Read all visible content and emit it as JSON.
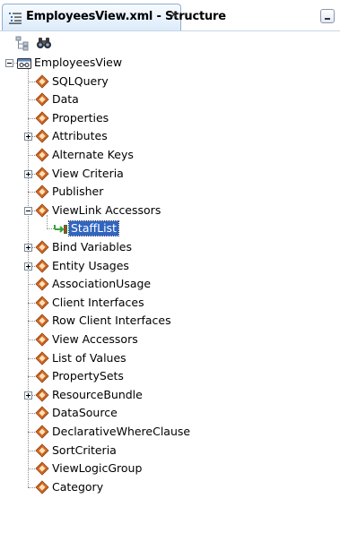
{
  "window": {
    "tab_title": "EmployeesView.xml - Structure",
    "close_glyph": "×"
  },
  "toolbar": {
    "buttons": [
      {
        "icon": "hierarchy-icon"
      },
      {
        "icon": "binoculars-icon"
      }
    ]
  },
  "colors": {
    "tab_bg": "#dcebfa",
    "selection_bg": "#3165c0",
    "node_icon": "#d9702a",
    "link_icon": "#3aa23a"
  },
  "tree": {
    "root": {
      "label": "EmployeesView",
      "icon": "view-object-icon",
      "state": "expanded"
    },
    "nodes": [
      {
        "label": "SQLQuery",
        "icon": "diamond-node-icon",
        "depth": 1,
        "expander": "none"
      },
      {
        "label": "Data",
        "icon": "diamond-node-icon",
        "depth": 1,
        "expander": "none"
      },
      {
        "label": "Properties",
        "icon": "diamond-node-icon",
        "depth": 1,
        "expander": "none"
      },
      {
        "label": "Attributes",
        "icon": "diamond-node-icon",
        "depth": 1,
        "expander": "collapsed"
      },
      {
        "label": "Alternate Keys",
        "icon": "diamond-node-icon",
        "depth": 1,
        "expander": "none"
      },
      {
        "label": "View Criteria",
        "icon": "diamond-node-icon",
        "depth": 1,
        "expander": "collapsed"
      },
      {
        "label": "Publisher",
        "icon": "diamond-node-icon",
        "depth": 1,
        "expander": "none"
      },
      {
        "label": "ViewLink Accessors",
        "icon": "diamond-node-icon",
        "depth": 1,
        "expander": "expanded"
      },
      {
        "label": "StaffList",
        "icon": "view-link-icon",
        "depth": 2,
        "expander": "none",
        "selected": true
      },
      {
        "label": "Bind Variables",
        "icon": "diamond-node-icon",
        "depth": 1,
        "expander": "collapsed"
      },
      {
        "label": "Entity Usages",
        "icon": "diamond-node-icon",
        "depth": 1,
        "expander": "collapsed"
      },
      {
        "label": "AssociationUsage",
        "icon": "diamond-node-icon",
        "depth": 1,
        "expander": "none"
      },
      {
        "label": "Client Interfaces",
        "icon": "diamond-node-icon",
        "depth": 1,
        "expander": "none"
      },
      {
        "label": "Row Client Interfaces",
        "icon": "diamond-node-icon",
        "depth": 1,
        "expander": "none"
      },
      {
        "label": "View Accessors",
        "icon": "diamond-node-icon",
        "depth": 1,
        "expander": "none"
      },
      {
        "label": "List of Values",
        "icon": "diamond-node-icon",
        "depth": 1,
        "expander": "none"
      },
      {
        "label": "PropertySets",
        "icon": "diamond-node-icon",
        "depth": 1,
        "expander": "none"
      },
      {
        "label": "ResourceBundle",
        "icon": "diamond-node-icon",
        "depth": 1,
        "expander": "collapsed"
      },
      {
        "label": "DataSource",
        "icon": "diamond-node-icon",
        "depth": 1,
        "expander": "none"
      },
      {
        "label": "DeclarativeWhereClause",
        "icon": "diamond-node-icon",
        "depth": 1,
        "expander": "none"
      },
      {
        "label": "SortCriteria",
        "icon": "diamond-node-icon",
        "depth": 1,
        "expander": "none"
      },
      {
        "label": "ViewLogicGroup",
        "icon": "diamond-node-icon",
        "depth": 1,
        "expander": "none"
      },
      {
        "label": "Category",
        "icon": "diamond-node-icon",
        "depth": 1,
        "expander": "none"
      }
    ]
  }
}
